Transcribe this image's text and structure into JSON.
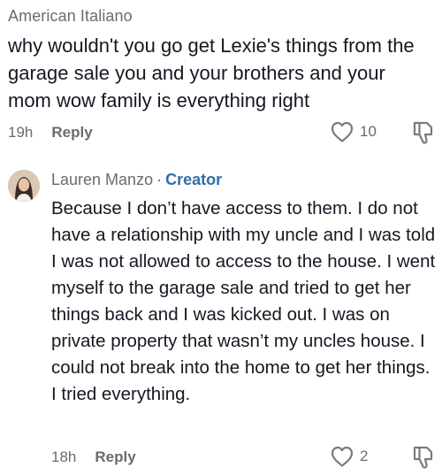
{
  "comments": [
    {
      "username": "American Italiano",
      "text": "why wouldn't you go get Lexie's things from the garage sale you and your brothers and your mom wow family is everything right",
      "time": "19h",
      "reply_label": "Reply",
      "like_count": "10",
      "icons": {
        "like": "heart-outline-icon",
        "dislike": "thumbs-down-icon"
      }
    },
    {
      "username": "Lauren Manzo",
      "separator": "·",
      "badge": "Creator",
      "text": "Because I don’t have access to them. I do not have a relationship with my uncle and I was told I was not allowed to access to the house. I went myself to the garage sale and tried to get her things back and I was kicked out. I was on private property that wasn’t my uncles house. I could not break into the home to get her things. I tried everything.",
      "time": "18h",
      "reply_label": "Reply",
      "like_count": "2",
      "icons": {
        "avatar": "avatar",
        "like": "heart-outline-icon",
        "dislike": "thumbs-down-icon"
      }
    }
  ],
  "colors": {
    "text": "#161823",
    "secondary": "#6b6b70",
    "creator_badge": "#2f6fa8"
  }
}
